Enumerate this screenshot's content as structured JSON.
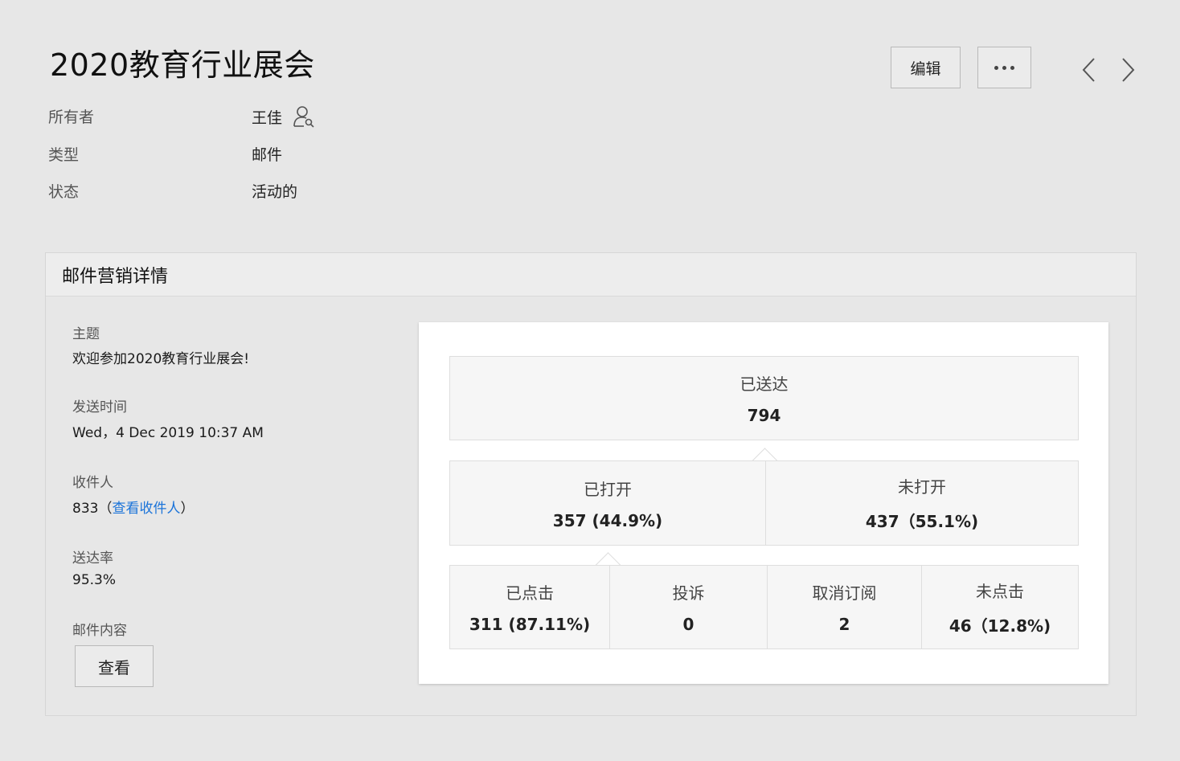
{
  "page": {
    "title": "2020教育行业展会",
    "edit_label": "编辑"
  },
  "meta": [
    {
      "label": "所有者",
      "value": "王佳"
    },
    {
      "label": "类型",
      "value": "邮件"
    },
    {
      "label": "状态",
      "value": "活动的"
    }
  ],
  "details": {
    "section_title": "邮件营销详情",
    "subject_label": "主题",
    "subject_value": "欢迎参加2020教育行业展会!",
    "send_time_label": "发送时间",
    "send_time_value": "Wed，4 Dec 2019 10:37 AM",
    "recipients_label": "收件人",
    "recipients_count": "833",
    "recipients_open": "（",
    "recipients_link": "查看收件人",
    "recipients_close": "）",
    "delivery_rate_label": "送达率",
    "delivery_rate_value": "95.3%",
    "content_label": "邮件内容",
    "view_button": "查看"
  },
  "stats": {
    "delivered": {
      "label": "已送达",
      "value": "794"
    },
    "opened": {
      "label": "已打开",
      "value": "357 (44.9%)"
    },
    "unopened": {
      "label": "未打开",
      "value": "437（55.1%)"
    },
    "clicked": {
      "label": "已点击",
      "value": "311 (87.11%)"
    },
    "complaints": {
      "label": "投诉",
      "value": "0"
    },
    "unsubscribed": {
      "label": "取消订阅",
      "value": "2"
    },
    "not_clicked": {
      "label": "未点击",
      "value": "46（12.8%)"
    }
  },
  "icons": {
    "owner": "user-search-icon",
    "more": "more-dots-icon",
    "prev": "chevron-left-icon",
    "next": "chevron-right-icon"
  }
}
